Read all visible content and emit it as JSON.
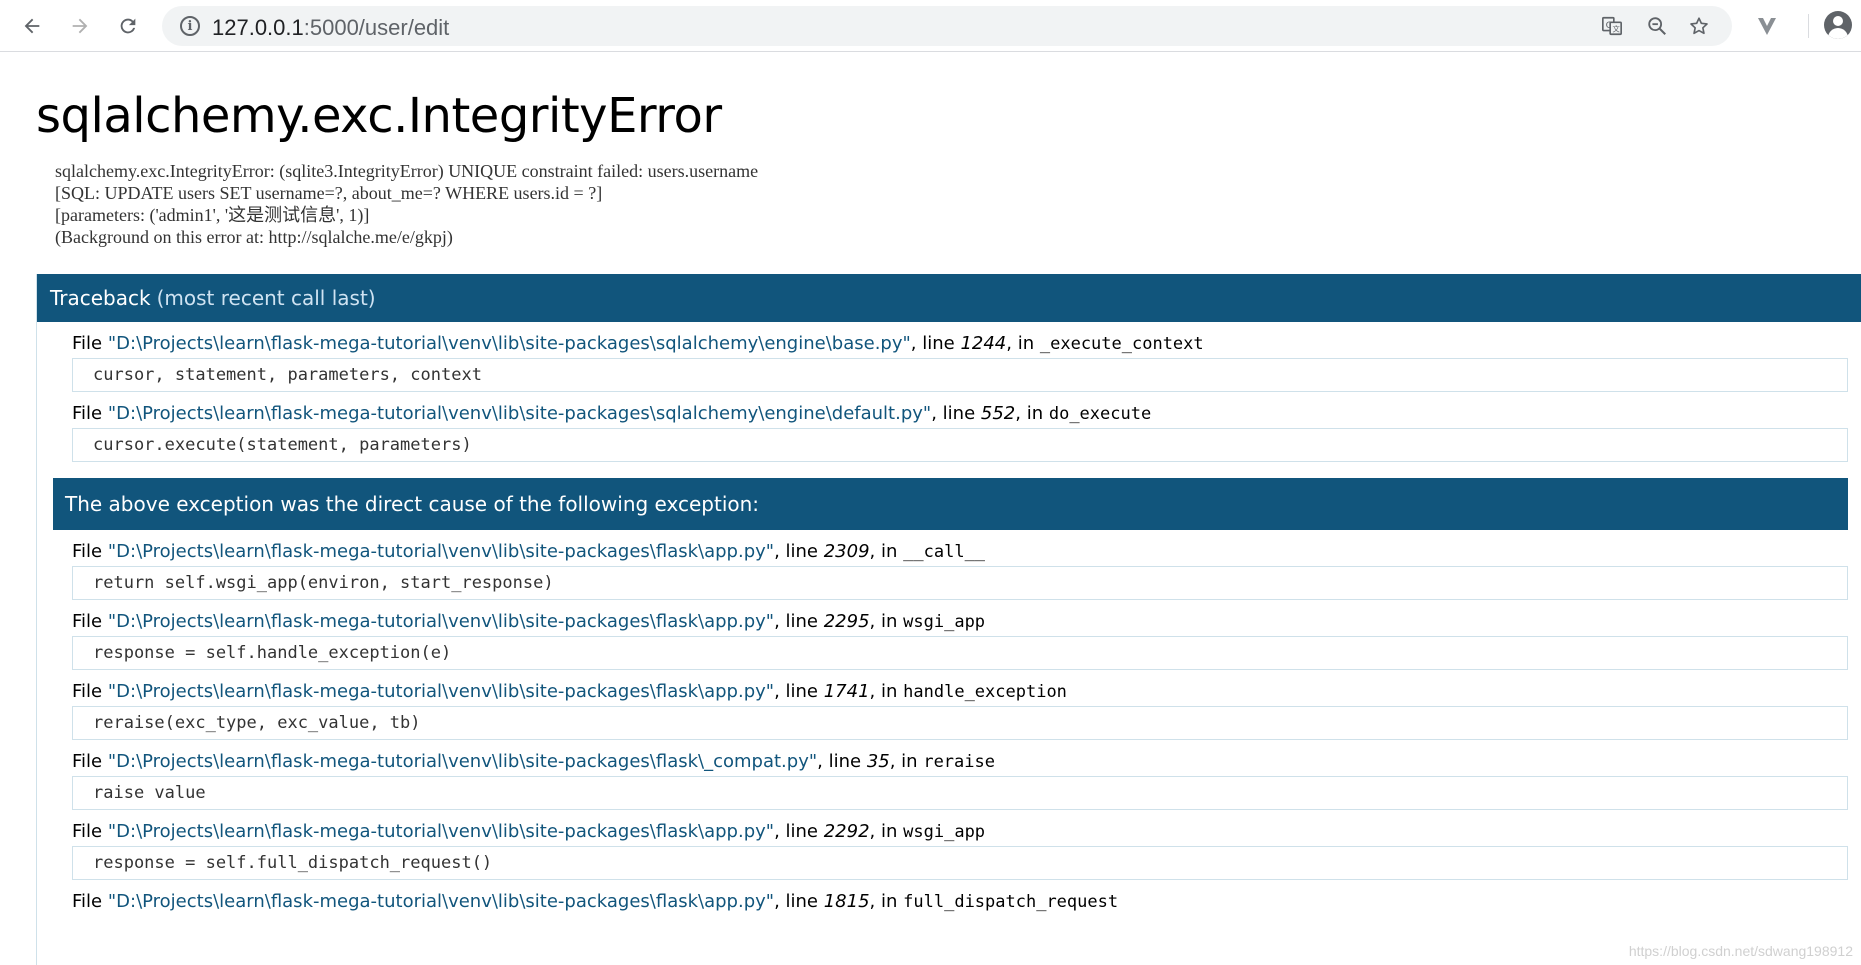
{
  "browser": {
    "url_host": "127.0.0.1",
    "url_path": ":5000/user/edit"
  },
  "error": {
    "title": "sqlalchemy.exc.IntegrityError",
    "message": "sqlalchemy.exc.IntegrityError: (sqlite3.IntegrityError) UNIQUE constraint failed: users.username\n[SQL: UPDATE users SET username=?, about_me=? WHERE users.id = ?]\n[parameters: ('admin1', '这是测试信息', 1)]\n(Background on this error at: http://sqlalche.me/e/gkpj)"
  },
  "traceback": {
    "header": "Traceback",
    "header_sub": "(most recent call last)",
    "cause_text": "The above exception was the direct cause of the following exception:",
    "file_word": "File",
    "line_word": "line",
    "in_word": "in",
    "frames_before": [
      {
        "file": "\"D:\\Projects\\learn\\flask-mega-tutorial\\venv\\lib\\site-packages\\sqlalchemy\\engine\\base.py\"",
        "line": "1244",
        "func": "_execute_context",
        "code": "cursor, statement, parameters, context"
      },
      {
        "file": "\"D:\\Projects\\learn\\flask-mega-tutorial\\venv\\lib\\site-packages\\sqlalchemy\\engine\\default.py\"",
        "line": "552",
        "func": "do_execute",
        "code": "cursor.execute(statement, parameters)"
      }
    ],
    "frames_after": [
      {
        "file": "\"D:\\Projects\\learn\\flask-mega-tutorial\\venv\\lib\\site-packages\\flask\\app.py\"",
        "line": "2309",
        "func": "__call__",
        "code": "return self.wsgi_app(environ, start_response)"
      },
      {
        "file": "\"D:\\Projects\\learn\\flask-mega-tutorial\\venv\\lib\\site-packages\\flask\\app.py\"",
        "line": "2295",
        "func": "wsgi_app",
        "code": "response = self.handle_exception(e)"
      },
      {
        "file": "\"D:\\Projects\\learn\\flask-mega-tutorial\\venv\\lib\\site-packages\\flask\\app.py\"",
        "line": "1741",
        "func": "handle_exception",
        "code": "reraise(exc_type, exc_value, tb)"
      },
      {
        "file": "\"D:\\Projects\\learn\\flask-mega-tutorial\\venv\\lib\\site-packages\\flask\\_compat.py\"",
        "line": "35",
        "func": "reraise",
        "code": "raise value"
      },
      {
        "file": "\"D:\\Projects\\learn\\flask-mega-tutorial\\venv\\lib\\site-packages\\flask\\app.py\"",
        "line": "2292",
        "func": "wsgi_app",
        "code": "response = self.full_dispatch_request()"
      },
      {
        "file": "\"D:\\Projects\\learn\\flask-mega-tutorial\\venv\\lib\\site-packages\\flask\\app.py\"",
        "line": "1815",
        "func": "full_dispatch_request",
        "code": ""
      }
    ]
  },
  "watermark": "https://blog.csdn.net/sdwang198912",
  "icons": {
    "back": "back-arrow-icon",
    "forward": "forward-arrow-icon",
    "reload": "reload-icon",
    "info": "info-icon",
    "translate": "translate-icon",
    "zoom": "zoom-out-icon",
    "bookmark": "star-icon",
    "extension": "extension-icon",
    "profile": "avatar-icon"
  },
  "colors": {
    "header_bg": "#11557c",
    "file_link": "#11557c",
    "code_border": "#cfe1ea"
  }
}
